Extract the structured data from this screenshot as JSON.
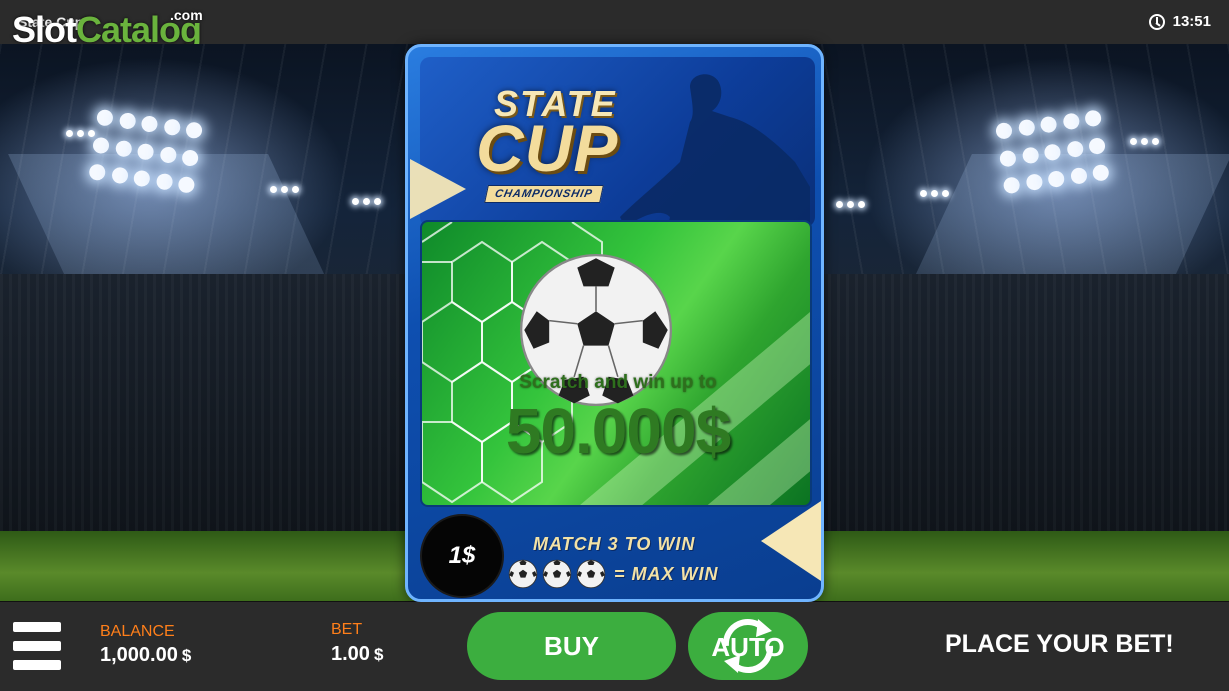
{
  "top_bar": {
    "game_title": "State Cup",
    "logo": {
      "slot": "Slot",
      "catalog": "Catalog",
      "dotcom": ".com"
    },
    "clock_icon": "clock-icon",
    "time": "13:51"
  },
  "card": {
    "title_state": "STATE",
    "title_cup": "CUP",
    "title_championship": "CHAMPIONSHIP",
    "scratch_prompt": "Scratch and win up to",
    "scratch_amount": "50.000$",
    "price": "1$",
    "match_text": "MATCH 3 TO WIN",
    "max_win_text": "= MAX WIN"
  },
  "bottom_bar": {
    "menu_icon": "hamburger-menu-icon",
    "balance_label": "BALANCE",
    "balance_value": "1,000.00",
    "balance_unit": "$",
    "bet_label": "BET",
    "bet_value": "1.00",
    "bet_unit": "$",
    "buy_label": "BUY",
    "auto_label": "AUTO",
    "status_text": "PLACE YOUR BET!"
  },
  "colors": {
    "bar_bg": "#2b2b2b",
    "button_green": "#3cae3f",
    "label_orange": "#ff7f1a",
    "logo_green": "#6ab33d",
    "card_blue": "#0e4fb0",
    "gold": "#f3dc9c"
  }
}
